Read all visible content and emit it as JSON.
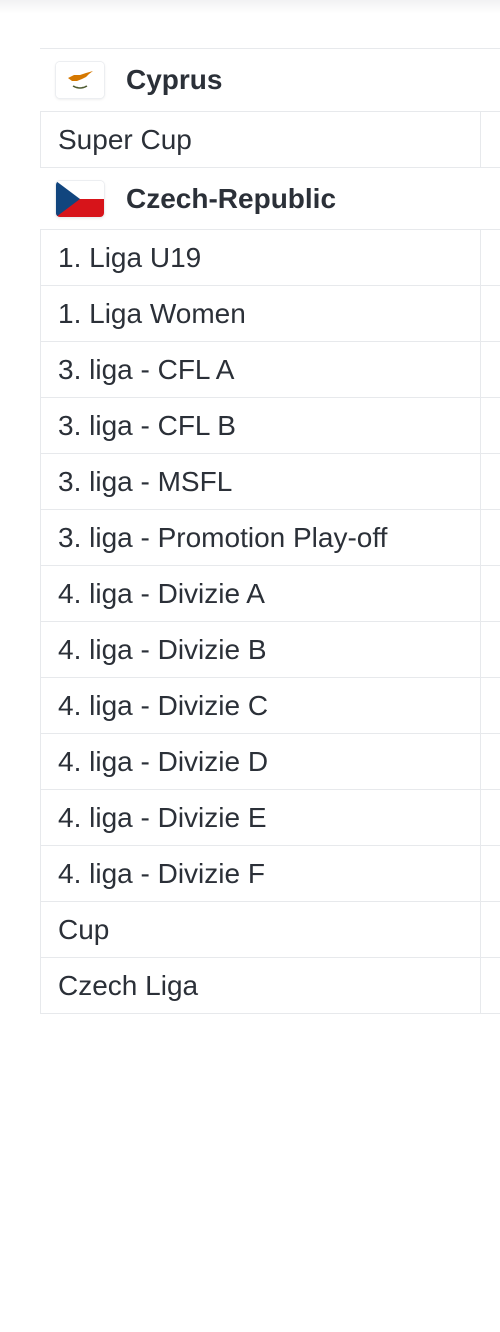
{
  "countries": [
    {
      "name": "Cyprus",
      "flag": "cyprus-flag-icon",
      "leagues": [
        "Super Cup"
      ]
    },
    {
      "name": "Czech-Republic",
      "flag": "czech-republic-flag-icon",
      "leagues": [
        "1. Liga U19",
        "1. Liga Women",
        "3. liga - CFL A",
        "3. liga - CFL B",
        "3. liga - MSFL",
        "3. liga - Promotion Play-off",
        "4. liga - Divizie A",
        "4. liga - Divizie B",
        "4. liga - Divizie C",
        "4. liga - Divizie D",
        "4. liga - Divizie E",
        "4. liga - Divizie F",
        "Cup",
        "Czech Liga"
      ]
    }
  ],
  "colors": {
    "cyprus_map": "#d57800",
    "cyprus_olive": "#4e5b31",
    "czech_blue": "#11457e",
    "czech_red": "#d7141a",
    "border": "#e7e9ec",
    "text": "#2b3038"
  }
}
